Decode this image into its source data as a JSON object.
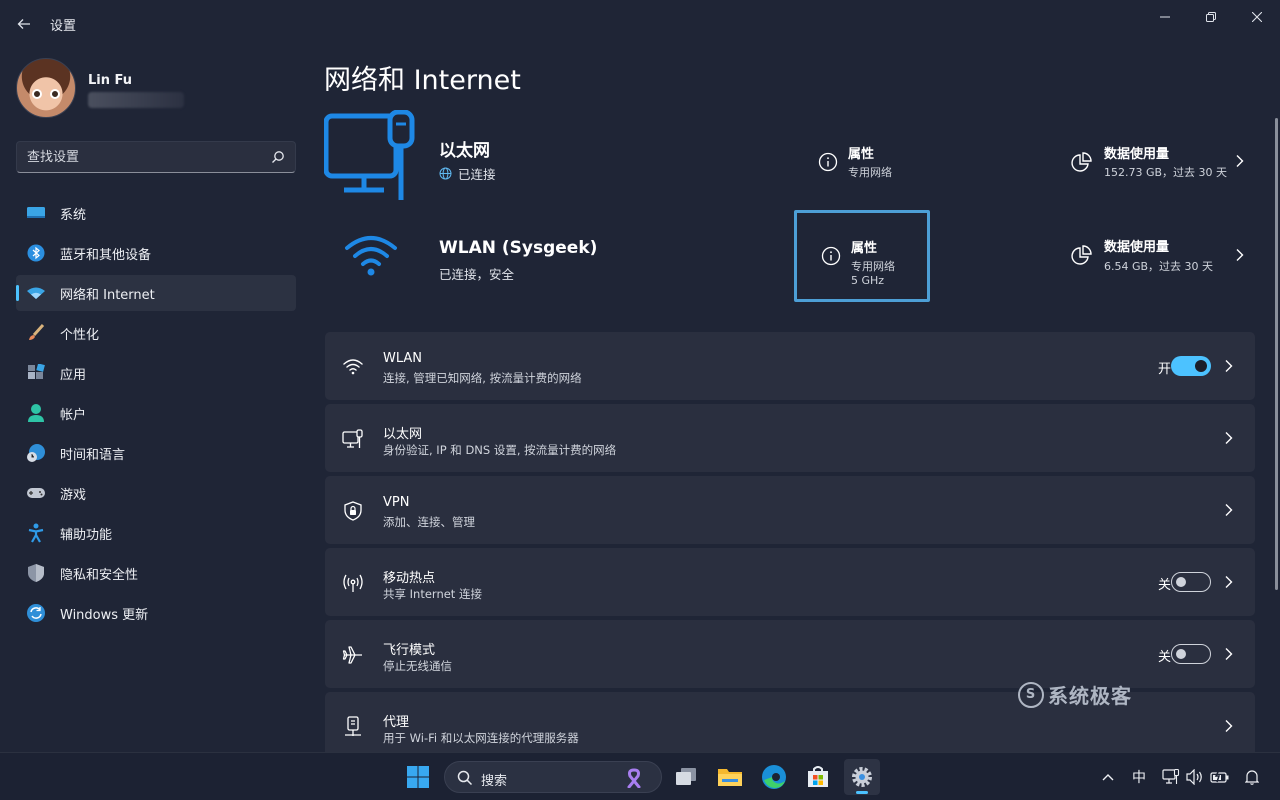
{
  "window": {
    "title": "设置"
  },
  "profile": {
    "name": "Lin Fu"
  },
  "search": {
    "placeholder": "查找设置"
  },
  "sidebar": {
    "items": [
      {
        "label": "系统",
        "icon": "system-icon"
      },
      {
        "label": "蓝牙和其他设备",
        "icon": "bluetooth-icon"
      },
      {
        "label": "网络和 Internet",
        "icon": "wifi-icon",
        "active": true
      },
      {
        "label": "个性化",
        "icon": "brush-icon"
      },
      {
        "label": "应用",
        "icon": "apps-icon"
      },
      {
        "label": "帐户",
        "icon": "account-icon"
      },
      {
        "label": "时间和语言",
        "icon": "globe-clock-icon"
      },
      {
        "label": "游戏",
        "icon": "gamepad-icon"
      },
      {
        "label": "辅助功能",
        "icon": "accessibility-icon"
      },
      {
        "label": "隐私和安全性",
        "icon": "shield-icon"
      },
      {
        "label": "Windows 更新",
        "icon": "update-icon"
      }
    ]
  },
  "main": {
    "title": "网络和 Internet",
    "ethernet": {
      "name": "以太网",
      "status": "已连接",
      "props_title": "属性",
      "props_sub": "专用网络",
      "usage_title": "数据使用量",
      "usage_sub": "152.73 GB，过去 30 天"
    },
    "wlan": {
      "name": "WLAN (Sysgeek)",
      "status": "已连接，安全",
      "props_title": "属性",
      "props_sub1": "专用网络",
      "props_sub2": "5 GHz",
      "usage_title": "数据使用量",
      "usage_sub": "6.54 GB，过去 30 天"
    },
    "cards": [
      {
        "title": "WLAN",
        "sub": "连接, 管理已知网络, 按流量计费的网络",
        "toggle_label": "开",
        "toggle": "on",
        "icon": "wifi-icon"
      },
      {
        "title": "以太网",
        "sub": "身份验证, IP 和 DNS 设置, 按流量计费的网络",
        "icon": "ethernet-icon"
      },
      {
        "title": "VPN",
        "sub": "添加、连接、管理",
        "icon": "vpn-shield-icon"
      },
      {
        "title": "移动热点",
        "sub": "共享 Internet 连接",
        "toggle_label": "关",
        "toggle": "off",
        "icon": "hotspot-icon"
      },
      {
        "title": "飞行模式",
        "sub": "停止无线通信",
        "toggle_label": "关",
        "toggle": "off",
        "icon": "airplane-icon"
      },
      {
        "title": "代理",
        "sub": "用于 Wi-Fi 和以太网连接的代理服务器",
        "icon": "proxy-icon"
      }
    ]
  },
  "watermark": {
    "text": "系统极客"
  },
  "taskbar": {
    "search_label": "搜索",
    "ime": "中"
  },
  "colors": {
    "accent": "#4cc2ff",
    "focus": "#4d9fd6",
    "card": "#2a2f3f",
    "background": "#1f2536"
  }
}
